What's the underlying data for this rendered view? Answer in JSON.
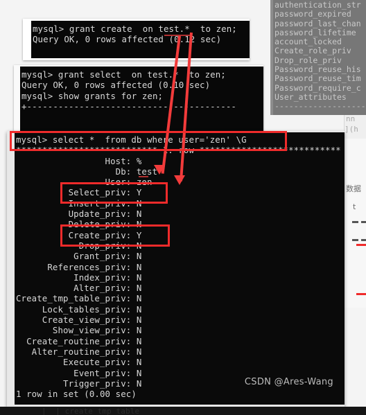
{
  "grey_panel": {
    "name": "mysql-user-table-columns-panel",
    "lines": [
      "authentication_str",
      "password_expired",
      "password_last_chan",
      "password_lifetime",
      "account_locked",
      "Create_role_priv",
      "Drop_role_priv",
      "Password_reuse_his",
      "Password_reuse_tim",
      "Password_require_c",
      "User_attributes"
    ],
    "divider": "-------------------"
  },
  "ide_panel": {
    "fragment_top": "nn",
    "fragment_bracket": "](h",
    "cn_fragment_1": "数据",
    "cn_fragment_2": "t"
  },
  "window1": {
    "title": "mysql terminal (grant create)",
    "lines": [
      "mysql> grant create  on test.*  to zen;",
      "Query OK, 0 rows affected (0.12 sec)"
    ]
  },
  "window2": {
    "title": "mysql terminal (grant select)",
    "lines": [
      "mysql> grant select  on test.*  to zen;",
      "Query OK, 0 rows affected (0.10 sec)",
      "",
      "mysql> show grants for zen;",
      "+----------------------------------------"
    ]
  },
  "window3": {
    "title": "mysql terminal (select from db)",
    "lines": [
      "mysql> select *  from db where user='zen' \\G",
      "*************************** 1. row ***************************",
      "                 Host: %",
      "                   Db: test",
      "                 User: zen",
      "          Select_priv: Y",
      "          Insert_priv: N",
      "          Update_priv: N",
      "          Delete_priv: N",
      "          Create_priv: Y",
      "            Drop_priv: N",
      "           Grant_priv: N",
      "      References_priv: N",
      "           Index_priv: N",
      "           Alter_priv: N",
      "Create_tmp_table_priv: N",
      "     Lock_tables_priv: N",
      "     Create_view_priv: N",
      "       Show_view_priv: N",
      "  Create_routine_priv: N",
      "   Alter_routine_priv: N",
      "         Execute_priv: N",
      "           Event_priv: N",
      "         Trigger_priv: N",
      "1 row in set (0.00 sec)"
    ]
  },
  "annotations": {
    "accent_color": "#ef2b2b",
    "box_select_insert": "Select_priv / Insert_priv highlight",
    "box_create_drop": "Create_priv / Drop_priv highlight",
    "box_query": "select query highlight",
    "arrow_1": "arrow from test.* (grant create) to Db: test",
    "arrow_2": "arrow from test.* (grant select) to User: zen"
  },
  "watermark": {
    "text": "CSDN @Ares-Wang"
  },
  "bottom_strip": {
    "text": "|  | create_tmp_table"
  }
}
